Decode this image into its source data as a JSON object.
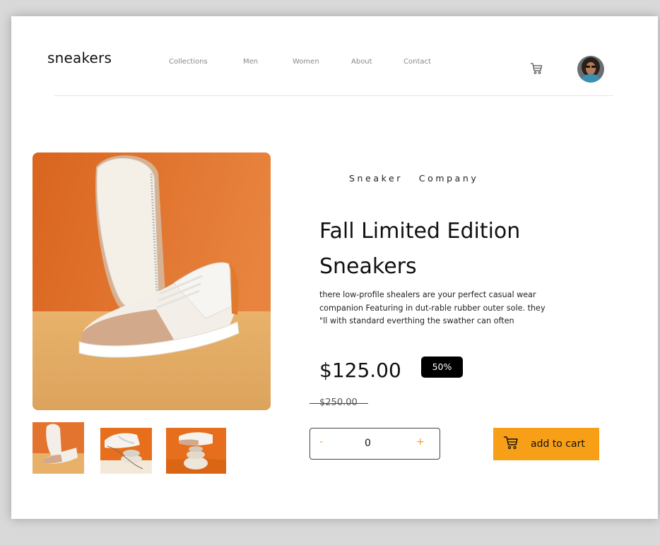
{
  "brand": {
    "logo": "sneakers"
  },
  "nav": {
    "items": [
      {
        "label": "Collections"
      },
      {
        "label": "Men"
      },
      {
        "label": "Women"
      },
      {
        "label": "About"
      },
      {
        "label": "Contact"
      }
    ]
  },
  "header": {
    "cart_icon": "cart-icon",
    "avatar_icon": "user-avatar"
  },
  "product": {
    "company": "Sneaker   Company",
    "title": "Fall Limited Edition Sneakers",
    "description": "there low-profile shealers are your perfect casual wear companion Featuring in dut-rable rubber outer sole. they \"ll with standard everthing the swather can often",
    "price": "$125.00",
    "discount": "50%",
    "old_price": "$250.00"
  },
  "cart": {
    "minus": "-",
    "plus": "+",
    "quantity": "0",
    "add_label": "add to cart"
  },
  "colors": {
    "accent": "#f7a017",
    "badge_bg": "#000000",
    "photo_orange": "#e2702a",
    "photo_sand": "#e9b370"
  }
}
